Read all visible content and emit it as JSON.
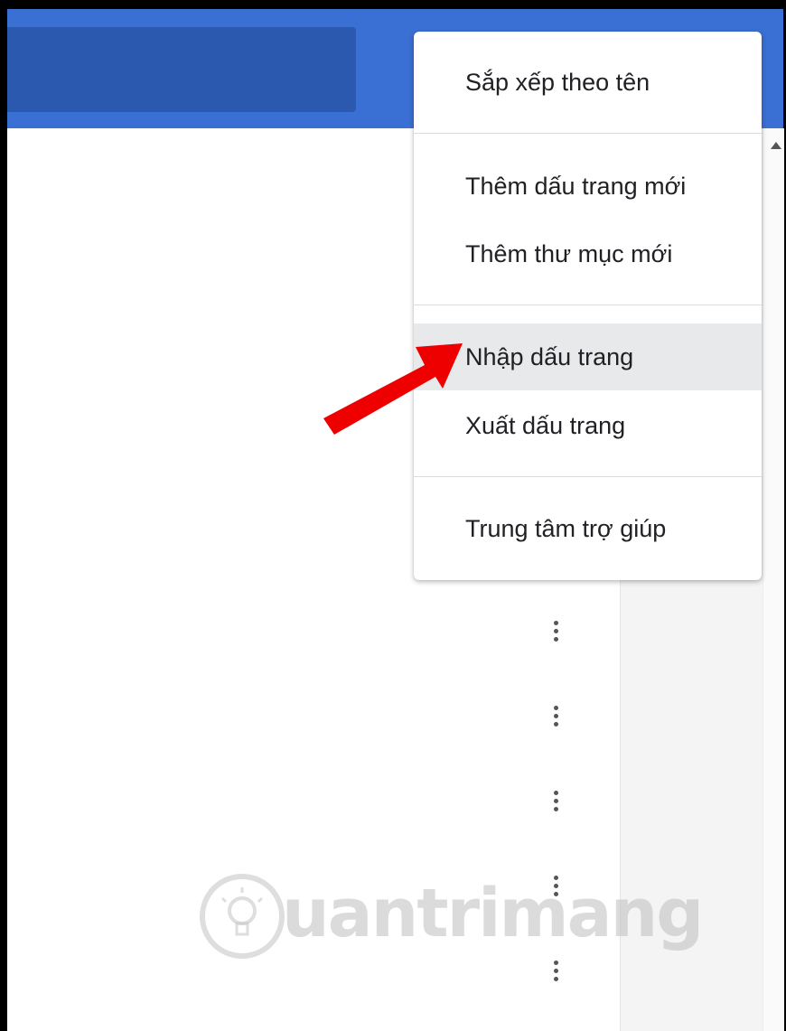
{
  "colors": {
    "header_blue": "#3a6fd3",
    "search_blue": "#2b59b0",
    "menu_highlight": "#e8e9eb",
    "arrow_red": "#ee0000"
  },
  "menu": {
    "items": [
      {
        "label": "Sắp xếp theo tên"
      },
      {
        "label": "Thêm dấu trang mới"
      },
      {
        "label": "Thêm thư mục mới"
      },
      {
        "label": "Nhập dấu trang"
      },
      {
        "label": "Xuất dấu trang"
      },
      {
        "label": "Trung tâm trợ giúp"
      }
    ],
    "highlighted": "Nhập dấu trang"
  },
  "icons": {
    "row_menu": "more-vert-icon",
    "scroll_up": "scroll-up-arrow-icon",
    "pointer": "red-arrow-icon"
  },
  "watermark": {
    "text": "uantrimang"
  }
}
